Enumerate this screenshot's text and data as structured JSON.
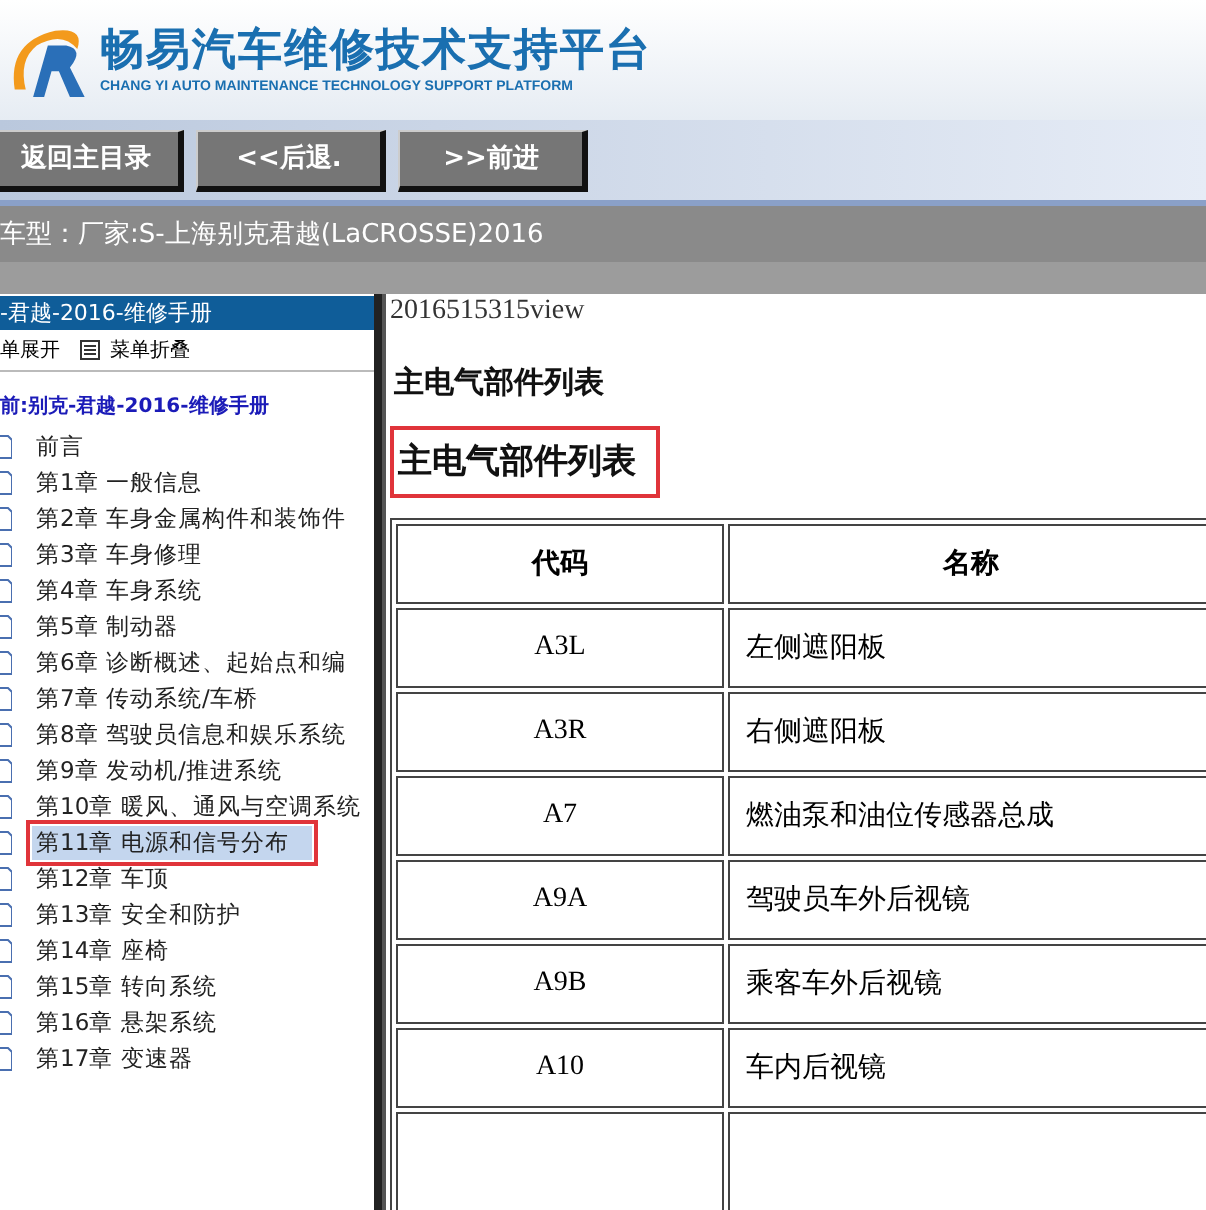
{
  "header": {
    "title": "畅易汽车维修技术支持平台",
    "subtitle": "CHANG YI AUTO MAINTENANCE TECHNOLOGY SUPPORT PLATFORM"
  },
  "nav_buttons": [
    "返回主目录",
    "<<后退.",
    ">>前进"
  ],
  "car_type": {
    "label": "车型：",
    "value": "厂家:S-上海别克君越(LaCROSSE)2016"
  },
  "sidebar": {
    "title": "-君越-2016-维修手册",
    "menu_actions": [
      {
        "kind": "expand",
        "label": "单展开"
      },
      {
        "kind": "collapse",
        "label": "菜单折叠"
      }
    ],
    "current": "前:别克-君越-2016-维修手册",
    "items": [
      {
        "label": "前言",
        "selected": false,
        "annotated": false
      },
      {
        "label": "第1章 一般信息",
        "selected": false,
        "annotated": false
      },
      {
        "label": "第2章 车身金属构件和装饰件",
        "selected": false,
        "annotated": false
      },
      {
        "label": "第3章 车身修理",
        "selected": false,
        "annotated": false
      },
      {
        "label": "第4章 车身系统",
        "selected": false,
        "annotated": false
      },
      {
        "label": "第5章 制动器",
        "selected": false,
        "annotated": false
      },
      {
        "label": "第6章 诊断概述、起始点和编",
        "selected": false,
        "annotated": false
      },
      {
        "label": "第7章 传动系统/车桥",
        "selected": false,
        "annotated": false
      },
      {
        "label": "第8章 驾驶员信息和娱乐系统",
        "selected": false,
        "annotated": false
      },
      {
        "label": "第9章 发动机/推进系统",
        "selected": false,
        "annotated": false
      },
      {
        "label": "第10章 暖风、通风与空调系统",
        "selected": false,
        "annotated": false
      },
      {
        "label": "第11章 电源和信号分布",
        "selected": true,
        "annotated": true
      },
      {
        "label": "第12章 车顶",
        "selected": false,
        "annotated": false
      },
      {
        "label": "第13章 安全和防护",
        "selected": false,
        "annotated": false
      },
      {
        "label": "第14章 座椅",
        "selected": false,
        "annotated": false
      },
      {
        "label": "第15章 转向系统",
        "selected": false,
        "annotated": false
      },
      {
        "label": "第16章 悬架系统",
        "selected": false,
        "annotated": false
      },
      {
        "label": "第17章 变速器",
        "selected": false,
        "annotated": false
      }
    ]
  },
  "content": {
    "doc_id": "2016515315view",
    "headings": [
      {
        "text": "主电气部件列表",
        "annotated": false
      },
      {
        "text": "主电气部件列表",
        "annotated": true
      }
    ],
    "table": {
      "columns": [
        "代码",
        "名称"
      ],
      "rows": [
        [
          "A3L",
          "左侧遮阳板"
        ],
        [
          "A3R",
          "右侧遮阳板"
        ],
        [
          "A7",
          "燃油泵和油位传感器总成"
        ],
        [
          "A9A",
          "驾驶员车外后视镜"
        ],
        [
          "A9B",
          "乘客车外后视镜"
        ],
        [
          "A10",
          "车内后视镜"
        ]
      ]
    }
  }
}
